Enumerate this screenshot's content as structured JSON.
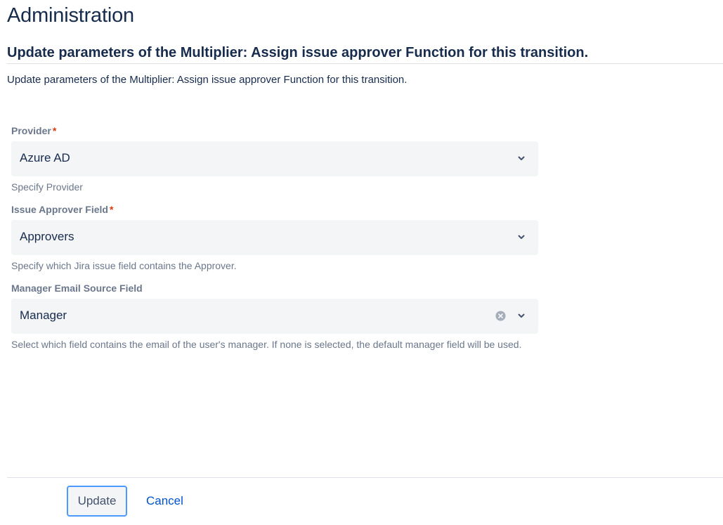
{
  "page": {
    "title": "Administration",
    "heading": "Update parameters of the Multiplier: Assign issue approver Function for this transition.",
    "description": "Update parameters of the Multiplier: Assign issue approver Function for this transition."
  },
  "form": {
    "provider": {
      "label": "Provider",
      "required_mark": "*",
      "value": "Azure AD",
      "help": "Specify Provider"
    },
    "issue_approver_field": {
      "label": "Issue Approver Field",
      "required_mark": "*",
      "value": "Approvers",
      "help": "Specify which Jira issue field contains the Approver."
    },
    "manager_email_source_field": {
      "label": "Manager Email Source Field",
      "value": "Manager",
      "help": "Select which field contains the email of the user's manager. If none is selected, the default manager field will be used."
    }
  },
  "actions": {
    "update_label": "Update",
    "cancel_label": "Cancel"
  },
  "colors": {
    "required": "#de350b",
    "link": "#0052cc",
    "focus_ring": "#4c9aff",
    "select_bg": "#f4f5f7"
  },
  "icons": {
    "dropdown": "chevron-down-icon",
    "clear": "clear-x-circle-icon"
  }
}
